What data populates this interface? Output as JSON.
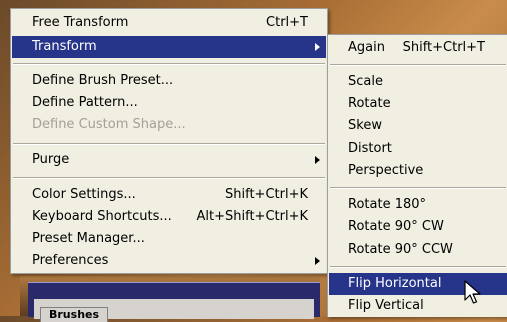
{
  "main_menu": {
    "items": [
      {
        "label": "Free Transform",
        "shortcut": "Ctrl+T"
      },
      {
        "label": "Transform",
        "shortcut": ""
      },
      {
        "label": "Define Brush Preset...",
        "shortcut": ""
      },
      {
        "label": "Define Pattern...",
        "shortcut": ""
      },
      {
        "label": "Define Custom Shape...",
        "shortcut": ""
      },
      {
        "label": "Purge",
        "shortcut": ""
      },
      {
        "label": "Color Settings...",
        "shortcut": "Shift+Ctrl+K"
      },
      {
        "label": "Keyboard Shortcuts...",
        "shortcut": "Alt+Shift+Ctrl+K"
      },
      {
        "label": "Preset Manager...",
        "shortcut": ""
      },
      {
        "label": "Preferences",
        "shortcut": ""
      }
    ]
  },
  "sub_menu": {
    "items": [
      {
        "label": "Again",
        "shortcut": "Shift+Ctrl+T"
      },
      {
        "label": "Scale",
        "shortcut": ""
      },
      {
        "label": "Rotate",
        "shortcut": ""
      },
      {
        "label": "Skew",
        "shortcut": ""
      },
      {
        "label": "Distort",
        "shortcut": ""
      },
      {
        "label": "Perspective",
        "shortcut": ""
      },
      {
        "label": "Rotate 180°",
        "shortcut": ""
      },
      {
        "label": "Rotate 90° CW",
        "shortcut": ""
      },
      {
        "label": "Rotate 90° CCW",
        "shortcut": ""
      },
      {
        "label": "Flip Horizontal",
        "shortcut": ""
      },
      {
        "label": "Flip Vertical",
        "shortcut": ""
      }
    ]
  },
  "background": {
    "panel_tab_label": "Brushes"
  },
  "colors": {
    "menu_bg": "#f1efe2",
    "highlight": "#26348a",
    "disabled_text": "#a3a095"
  },
  "icons": {
    "submenu_arrow": "chevron-right-icon",
    "cursor": "mouse-pointer-icon"
  }
}
